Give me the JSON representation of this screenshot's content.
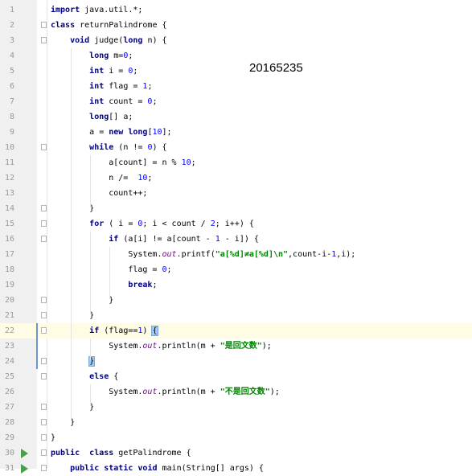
{
  "editor": {
    "overlay_text": "20165235",
    "active_line": 22,
    "lines": [
      {
        "n": "1",
        "fold": false,
        "run": false,
        "tokens": [
          {
            "t": "import",
            "c": "kw"
          },
          {
            "t": " java.util.*;"
          }
        ]
      },
      {
        "n": "2",
        "fold": true,
        "run": false,
        "tokens": [
          {
            "t": "class",
            "c": "kw"
          },
          {
            "t": " returnPalindrome {"
          }
        ]
      },
      {
        "n": "3",
        "fold": true,
        "run": false,
        "tokens": [
          {
            "t": "    "
          },
          {
            "t": "void",
            "c": "kw"
          },
          {
            "t": " judge("
          },
          {
            "t": "long",
            "c": "kw"
          },
          {
            "t": " n) {"
          }
        ]
      },
      {
        "n": "4",
        "fold": false,
        "run": false,
        "tokens": [
          {
            "t": "        "
          },
          {
            "t": "long",
            "c": "kw"
          },
          {
            "t": " m="
          },
          {
            "t": "0",
            "c": "num"
          },
          {
            "t": ";"
          }
        ]
      },
      {
        "n": "5",
        "fold": false,
        "run": false,
        "tokens": [
          {
            "t": "        "
          },
          {
            "t": "int",
            "c": "kw"
          },
          {
            "t": " i = "
          },
          {
            "t": "0",
            "c": "num"
          },
          {
            "t": ";"
          }
        ]
      },
      {
        "n": "6",
        "fold": false,
        "run": false,
        "tokens": [
          {
            "t": "        "
          },
          {
            "t": "int",
            "c": "kw"
          },
          {
            "t": " flag = "
          },
          {
            "t": "1",
            "c": "num"
          },
          {
            "t": ";"
          }
        ]
      },
      {
        "n": "7",
        "fold": false,
        "run": false,
        "tokens": [
          {
            "t": "        "
          },
          {
            "t": "int",
            "c": "kw"
          },
          {
            "t": " count = "
          },
          {
            "t": "0",
            "c": "num"
          },
          {
            "t": ";"
          }
        ]
      },
      {
        "n": "8",
        "fold": false,
        "run": false,
        "tokens": [
          {
            "t": "        "
          },
          {
            "t": "long",
            "c": "kw"
          },
          {
            "t": "[] a;"
          }
        ]
      },
      {
        "n": "9",
        "fold": false,
        "run": false,
        "tokens": [
          {
            "t": "        a = "
          },
          {
            "t": "new",
            "c": "kw"
          },
          {
            "t": " "
          },
          {
            "t": "long",
            "c": "kw"
          },
          {
            "t": "["
          },
          {
            "t": "10",
            "c": "num"
          },
          {
            "t": "];"
          }
        ]
      },
      {
        "n": "10",
        "fold": true,
        "run": false,
        "tokens": [
          {
            "t": "        "
          },
          {
            "t": "while",
            "c": "kw"
          },
          {
            "t": " (n != "
          },
          {
            "t": "0",
            "c": "num"
          },
          {
            "t": ") {"
          }
        ]
      },
      {
        "n": "11",
        "fold": false,
        "run": false,
        "tokens": [
          {
            "t": "            a[count] = n % "
          },
          {
            "t": "10",
            "c": "num"
          },
          {
            "t": ";"
          }
        ]
      },
      {
        "n": "12",
        "fold": false,
        "run": false,
        "tokens": [
          {
            "t": "            n /=  "
          },
          {
            "t": "10",
            "c": "num"
          },
          {
            "t": ";"
          }
        ]
      },
      {
        "n": "13",
        "fold": false,
        "run": false,
        "tokens": [
          {
            "t": "            count++;"
          }
        ]
      },
      {
        "n": "14",
        "fold": true,
        "run": false,
        "tokens": [
          {
            "t": "        }"
          }
        ]
      },
      {
        "n": "15",
        "fold": true,
        "run": false,
        "tokens": [
          {
            "t": "        "
          },
          {
            "t": "for",
            "c": "kw"
          },
          {
            "t": " ( i = "
          },
          {
            "t": "0",
            "c": "num"
          },
          {
            "t": "; i < count / "
          },
          {
            "t": "2",
            "c": "num"
          },
          {
            "t": "; i++) {"
          }
        ]
      },
      {
        "n": "16",
        "fold": true,
        "run": false,
        "tokens": [
          {
            "t": "            "
          },
          {
            "t": "if",
            "c": "kw"
          },
          {
            "t": " (a[i] != a[count - "
          },
          {
            "t": "1",
            "c": "num"
          },
          {
            "t": " - i]) {"
          }
        ]
      },
      {
        "n": "17",
        "fold": false,
        "run": false,
        "tokens": [
          {
            "t": "                System."
          },
          {
            "t": "out",
            "c": "field"
          },
          {
            "t": ".printf("
          },
          {
            "t": "\"a[%d]≠a[%d]\\n\"",
            "c": "str"
          },
          {
            "t": ",count-i-"
          },
          {
            "t": "1",
            "c": "num"
          },
          {
            "t": ",i);"
          }
        ]
      },
      {
        "n": "18",
        "fold": false,
        "run": false,
        "tokens": [
          {
            "t": "                flag = "
          },
          {
            "t": "0",
            "c": "num"
          },
          {
            "t": ";"
          }
        ]
      },
      {
        "n": "19",
        "fold": false,
        "run": false,
        "tokens": [
          {
            "t": "                "
          },
          {
            "t": "break",
            "c": "kw"
          },
          {
            "t": ";"
          }
        ]
      },
      {
        "n": "20",
        "fold": true,
        "run": false,
        "tokens": [
          {
            "t": "            }"
          }
        ]
      },
      {
        "n": "21",
        "fold": true,
        "run": false,
        "tokens": [
          {
            "t": "        }"
          }
        ]
      },
      {
        "n": "22",
        "fold": true,
        "run": false,
        "tokens": [
          {
            "t": "        "
          },
          {
            "t": "if",
            "c": "kw"
          },
          {
            "t": " (flag=="
          },
          {
            "t": "1",
            "c": "num"
          },
          {
            "t": ") "
          },
          {
            "t": "{",
            "c": "brace"
          }
        ]
      },
      {
        "n": "23",
        "fold": false,
        "run": false,
        "tokens": [
          {
            "t": "            System."
          },
          {
            "t": "out",
            "c": "field"
          },
          {
            "t": ".println(m + "
          },
          {
            "t": "\"是回文数\"",
            "c": "str"
          },
          {
            "t": ");"
          }
        ]
      },
      {
        "n": "24",
        "fold": true,
        "run": false,
        "tokens": [
          {
            "t": "        "
          },
          {
            "t": "}",
            "c": "brace"
          }
        ]
      },
      {
        "n": "25",
        "fold": true,
        "run": false,
        "tokens": [
          {
            "t": "        "
          },
          {
            "t": "else",
            "c": "kw"
          },
          {
            "t": " {"
          }
        ]
      },
      {
        "n": "26",
        "fold": false,
        "run": false,
        "tokens": [
          {
            "t": "            System."
          },
          {
            "t": "out",
            "c": "field"
          },
          {
            "t": ".println(m + "
          },
          {
            "t": "\"不是回文数\"",
            "c": "str"
          },
          {
            "t": ");"
          }
        ]
      },
      {
        "n": "27",
        "fold": true,
        "run": false,
        "tokens": [
          {
            "t": "        }"
          }
        ]
      },
      {
        "n": "28",
        "fold": true,
        "run": false,
        "tokens": [
          {
            "t": "    }"
          }
        ]
      },
      {
        "n": "29",
        "fold": true,
        "run": false,
        "tokens": [
          {
            "t": "}"
          }
        ]
      },
      {
        "n": "30",
        "fold": true,
        "run": true,
        "tokens": [
          {
            "t": "public",
            "c": "kw"
          },
          {
            "t": "  "
          },
          {
            "t": "class",
            "c": "kw"
          },
          {
            "t": " getPalindrome {"
          }
        ]
      },
      {
        "n": "31",
        "fold": true,
        "run": true,
        "tokens": [
          {
            "t": "    "
          },
          {
            "t": "public",
            "c": "kw"
          },
          {
            "t": " "
          },
          {
            "t": "static",
            "c": "kw"
          },
          {
            "t": " "
          },
          {
            "t": "void",
            "c": "kw"
          },
          {
            "t": " main(String[] args) {"
          }
        ]
      }
    ]
  }
}
